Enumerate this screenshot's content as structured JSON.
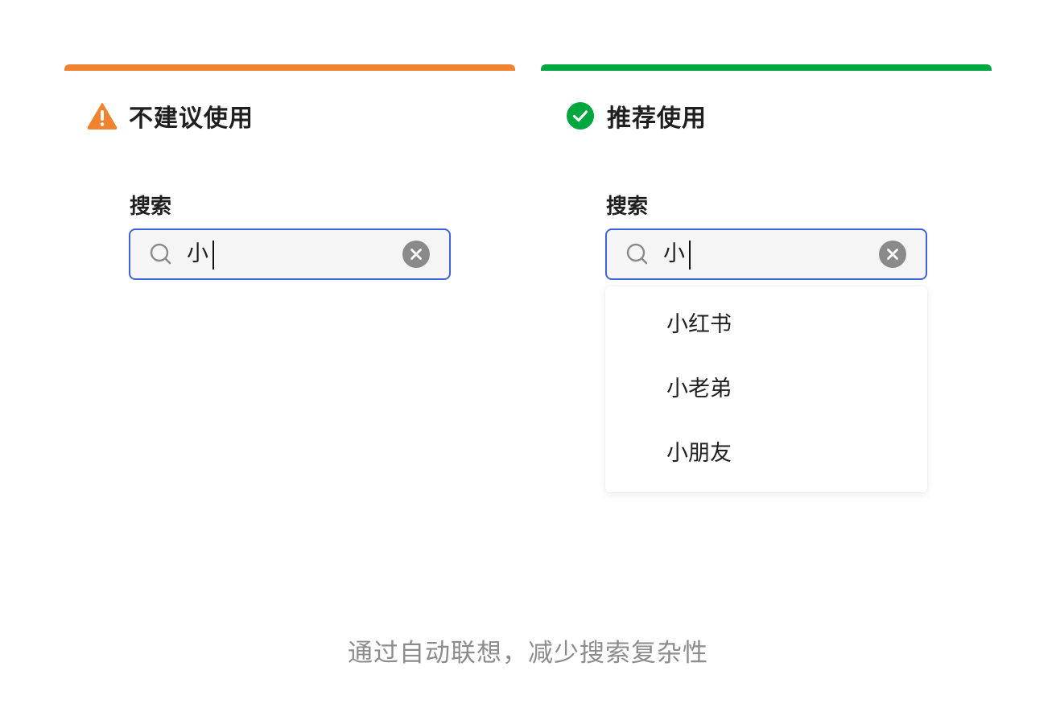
{
  "colors": {
    "bad_accent": "#f08330",
    "good_accent": "#00a63e",
    "focus_border": "#3d63dd",
    "caption_text": "#8c8c8c"
  },
  "bad_panel": {
    "title": "不建议使用",
    "status_icon": "warning-triangle-icon",
    "field_label": "搜索",
    "search": {
      "value": "小",
      "search_icon": "search-icon",
      "clear_icon": "clear-circle-icon"
    }
  },
  "good_panel": {
    "title": "推荐使用",
    "status_icon": "check-circle-icon",
    "field_label": "搜索",
    "search": {
      "value": "小",
      "search_icon": "search-icon",
      "clear_icon": "clear-circle-icon"
    },
    "suggestions": [
      "小红书",
      "小老弟",
      "小朋友"
    ]
  },
  "caption": "通过自动联想，减少搜索复杂性"
}
